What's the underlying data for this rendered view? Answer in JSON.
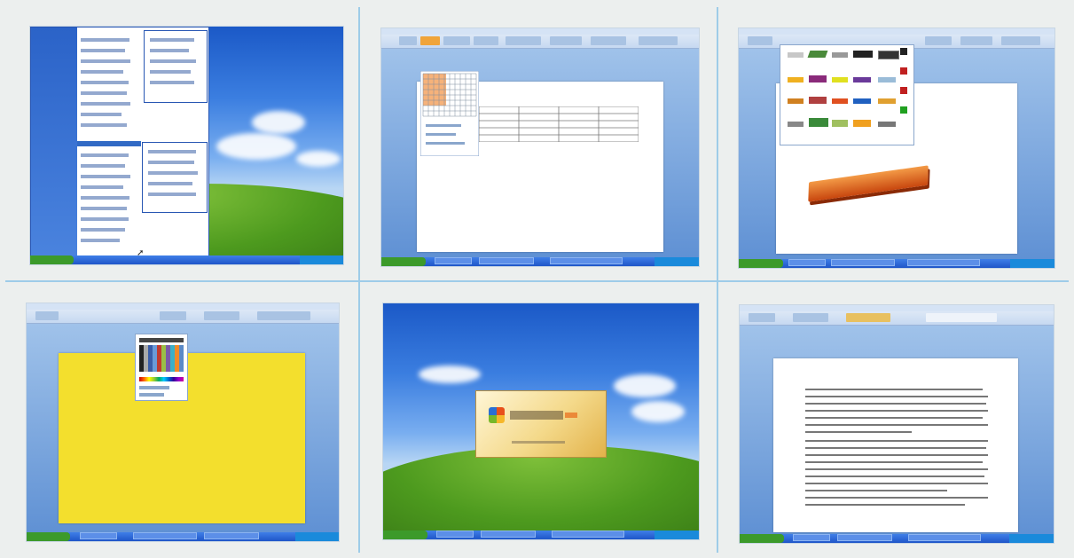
{
  "panels": [
    {
      "id": "windows-start-menu",
      "label": "",
      "taskbar_items": 0
    },
    {
      "id": "word-insert-table",
      "label": "",
      "taskbar_items": 3
    },
    {
      "id": "word-wordart",
      "label": "",
      "taskbar_items": 3
    },
    {
      "id": "word-page-color",
      "label": "",
      "taskbar_items": 3
    },
    {
      "id": "office-splash",
      "label": "",
      "taskbar_items": 3
    },
    {
      "id": "word-document-text",
      "label": "",
      "taskbar_items": 3
    }
  ],
  "colors": {
    "sky_top": "#1b59c7",
    "grass": "#4d9a1e",
    "page_yellow": "#f3df2d",
    "splash": "#f4d98a",
    "wordart": "#e85a1c",
    "grid_divider": "#9ecce8",
    "taskbar": "#1f56c8",
    "start_green": "#3c9a2a"
  }
}
